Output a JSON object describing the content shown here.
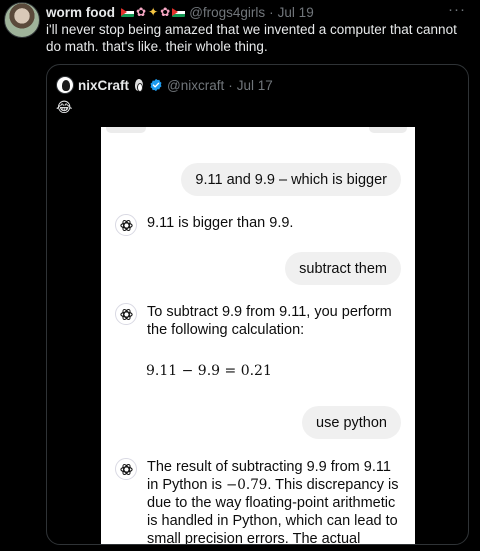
{
  "tweet": {
    "author_name": "worm food",
    "handle": "@frogs4girls",
    "date": "Jul 19",
    "separator": "·",
    "more": "···",
    "text": "i'll never stop being amazed that we invented a computer that cannot do math. that's like. their whole thing.",
    "name_decorations": [
      "palestine-flag-icon",
      "cherry-blossom-icon",
      "sparkles-icon",
      "cherry-blossom-icon",
      "palestine-flag-icon"
    ]
  },
  "quote": {
    "author_name": "nixCraft",
    "handle": "@nixcraft",
    "date": "Jul 17",
    "separator": "·",
    "emoji": "😂",
    "badges": [
      "penguin-icon",
      "verified-badge-icon"
    ]
  },
  "chat": {
    "messages": [
      {
        "role": "user",
        "text": "9.11 and 9.9 – which is bigger"
      },
      {
        "role": "assistant",
        "text": "9.11 is bigger than 9.9."
      },
      {
        "role": "user",
        "text": "subtract them"
      },
      {
        "role": "assistant",
        "text": "To subtract 9.9 from 9.11, you perform the following calculation:"
      },
      {
        "role": "math",
        "text": "9.11 − 9.9 = 0.21"
      },
      {
        "role": "user",
        "text": "use python"
      },
      {
        "role": "assistant",
        "text_before": "The result of subtracting 9.9 from 9.11 in Python is ",
        "math": "−0.79",
        "text_after": ". This discrepancy is due to the way floating-point arithmetic is handled in Python, which can lead to small precision errors. The actual"
      }
    ]
  },
  "colors": {
    "background": "#000000",
    "text_primary": "#e7e9ea",
    "text_secondary": "#71767b",
    "border": "#2f3336",
    "verified": "#1d9bf0",
    "chat_bubble": "#f0f0f0"
  }
}
